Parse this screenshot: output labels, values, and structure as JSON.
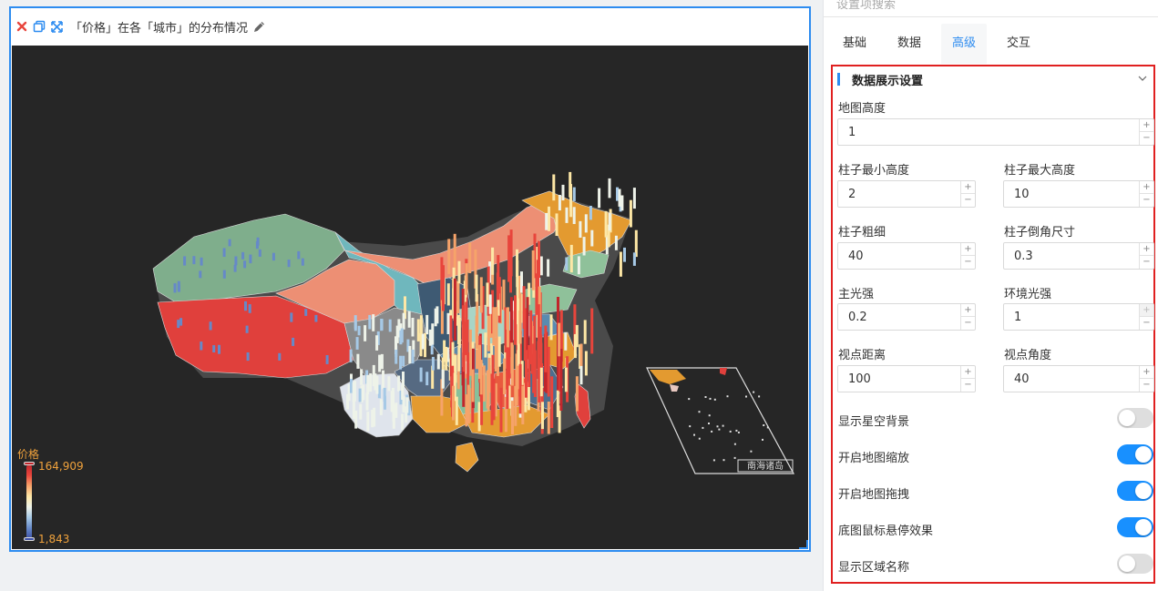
{
  "widget": {
    "title": "「价格」在各「城市」的分布情况",
    "legend": {
      "title": "价格",
      "max": "164,909",
      "min": "1,843"
    },
    "inset_label": "南海诸岛"
  },
  "panel": {
    "search_placeholder": "设置项搜索",
    "tabs": [
      {
        "label": "基础",
        "active": false
      },
      {
        "label": "数据",
        "active": false
      },
      {
        "label": "高级",
        "active": true
      },
      {
        "label": "交互",
        "active": false
      }
    ],
    "section": {
      "title": "数据展示设置",
      "fields": {
        "map_height": {
          "label": "地图高度",
          "value": "1"
        },
        "bar_min_height": {
          "label": "柱子最小高度",
          "value": "2"
        },
        "bar_max_height": {
          "label": "柱子最大高度",
          "value": "10"
        },
        "bar_width": {
          "label": "柱子粗细",
          "value": "40"
        },
        "bar_bevel": {
          "label": "柱子倒角尺寸",
          "value": "0.3"
        },
        "main_light": {
          "label": "主光强",
          "value": "0.2"
        },
        "ambient_light": {
          "label": "环境光强",
          "value": "1"
        },
        "view_distance": {
          "label": "视点距离",
          "value": "100"
        },
        "view_angle": {
          "label": "视点角度",
          "value": "40"
        }
      },
      "switches": [
        {
          "label": "显示星空背景",
          "on": false
        },
        {
          "label": "开启地图缩放",
          "on": true
        },
        {
          "label": "开启地图拖拽",
          "on": true
        },
        {
          "label": "底图鼠标悬停效果",
          "on": true
        },
        {
          "label": "显示区域名称",
          "on": false
        }
      ]
    }
  },
  "colors": {
    "accent": "#2d8cf0",
    "highlight_border": "#e02020",
    "switch_on": "#1890ff",
    "chart_bg": "#262626",
    "legend_text": "#f0a23c"
  },
  "icons": [
    "close-icon",
    "copy-icon",
    "expand-icon",
    "edit-pencil-icon",
    "chevron-down-icon"
  ]
}
